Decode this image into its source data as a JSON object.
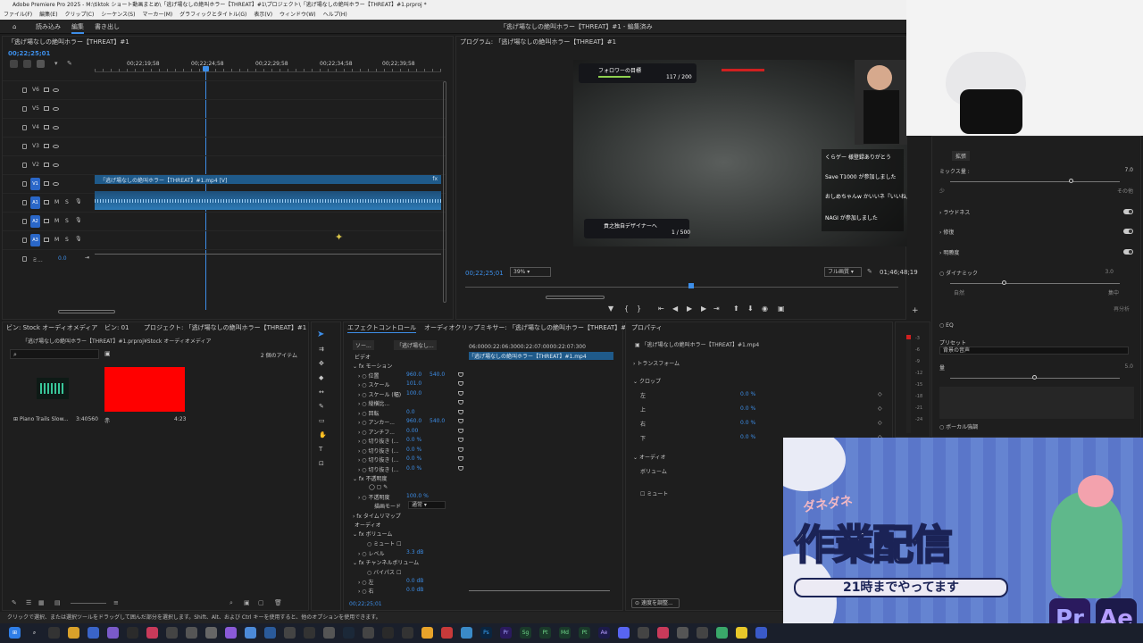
{
  "window": {
    "title": "Adobe Premiere Pro 2025 - M:\\tiktok ショート動画まとめ\\「逃げ場なしの絶叫ホラー【THREAT】#1\\プロジェクト\\「逃げ場なしの絶叫ホラー【THREAT】#1.prproj *"
  },
  "menu": [
    "ファイル(F)",
    "編集(E)",
    "クリップ(C)",
    "シーケンス(S)",
    "マーカー(M)",
    "グラフィックとタイトル(G)",
    "表示(V)",
    "ウィンドウ(W)",
    "ヘルプ(H)"
  ],
  "workspace": {
    "tabs": [
      "読み込み",
      "編集",
      "書き出し"
    ],
    "active_title": "「逃げ場なしの絶叫ホラー【THREAT】#1 - 編集済み"
  },
  "timeline": {
    "tab_title": "「逃げ場なしの絶叫ホラー【THREAT】#1",
    "timecode": "00;22;25;01",
    "ruler": [
      "00;22;19;58",
      "00;22;24;58",
      "00;22;29;58",
      "00;22;34;58",
      "00;22;39;58"
    ],
    "video_tracks": [
      "V6",
      "V5",
      "V4",
      "V3",
      "V2",
      "V1"
    ],
    "audio_tracks": [
      "A1",
      "A2",
      "A3"
    ],
    "mix_label": "ミ...",
    "mix_value": "0.0",
    "clip_label": "「逃げ場なしの絶叫ホラー【THREAT】#1.mp4 [V]",
    "fx_label": "fx"
  },
  "program": {
    "title": "プログラム: 「逃げ場なしの絶叫ホラー【THREAT】#1",
    "timecode": "00;22;25;01",
    "zoom": "39%",
    "quality": "フル画質",
    "duration": "01;46;48;19",
    "overlay_top_label": "フォロワーの目標",
    "overlay_top_count": "117 / 200",
    "overlay_bottom_label": "貢之独自デザイナーへ",
    "overlay_bottom_count": "1 / 500",
    "chat": [
      "くらゲー 様登録ありがとう",
      "Save T1000 が参加しました",
      "おしめちゃんw かいいネ『いいね』",
      "NAGI が参加しました"
    ]
  },
  "project_panel": {
    "tabs": [
      "ビン: Stock オーディオメディア",
      "ビン: 01",
      "プロジェクト: 「逃げ場なしの絶叫ホラー【THREAT】#1"
    ],
    "path": "「逃げ場なしの絶叫ホラー【THREAT】#1.prproj¥Stock オーディオメディア",
    "item_count": "2 個のアイテム",
    "item1_name": "Piano Trails Slow...",
    "item1_duration": "3:40560",
    "item2_name": "赤",
    "item2_duration": "4:23"
  },
  "effect_controls": {
    "tabs": [
      "エフェクトコントロール",
      "オーディオクリップミキサー: 「逃げ場なしの絶叫ホラー【THREAT】#1"
    ],
    "source_tab": "ソー...",
    "seq_tab": "「逃げ場なし...",
    "ruler": "06:0000:22:06:3000:22:07:0000:22:07:300",
    "clip_name": "「逃げ場なしの絶叫ホラー【THREAT】#1.mp4",
    "video_header": "ビデオ",
    "motion": "モーション",
    "rows": [
      {
        "name": "位置",
        "v1": "960.0",
        "v2": "540.0"
      },
      {
        "name": "スケール",
        "v1": "101.0",
        "v2": ""
      },
      {
        "name": "スケール (幅)",
        "v1": "100.0",
        "v2": ""
      },
      {
        "name": "縦横比...",
        "v1": "",
        "v2": ""
      },
      {
        "name": "回転",
        "v1": "0.0",
        "v2": ""
      },
      {
        "name": "アンカー...",
        "v1": "960.0",
        "v2": "540.0"
      },
      {
        "name": "アンチフ...",
        "v1": "0.00",
        "v2": ""
      },
      {
        "name": "切り抜き (...",
        "v1": "0.0 %",
        "v2": ""
      },
      {
        "name": "切り抜き (...",
        "v1": "0.0 %",
        "v2": ""
      },
      {
        "name": "切り抜き (...",
        "v1": "0.0 %",
        "v2": ""
      },
      {
        "name": "切り抜き (...",
        "v1": "0.0 %",
        "v2": ""
      }
    ],
    "opacity": "不透明度",
    "opacity_row": {
      "name": "不透明度",
      "v1": "100.0 %"
    },
    "blend_mode": "描画モード",
    "blend_value": "通常",
    "time_remap": "タイムリマップ",
    "audio_header": "オーディオ",
    "volume": "ボリューム",
    "mute": "ミュート",
    "level": "レベル",
    "level_value": "3.3 dB",
    "channel_volume": "チャンネルボリューム",
    "bypass": "バイパス",
    "left": "左",
    "left_value": "0.0 dB",
    "right": "右",
    "right_value": "0.0 dB",
    "timecode": "00;22;25;01"
  },
  "properties": {
    "title": "プロパティ",
    "clip_name": "「逃げ場なしの絶叫ホラー【THREAT】#1.mp4",
    "transform": "トランスフォーム",
    "crop": "クロップ",
    "crop_rows": [
      {
        "name": "左",
        "value": "0.0 %"
      },
      {
        "name": "上",
        "value": "0.0 %"
      },
      {
        "name": "右",
        "value": "0.0 %"
      },
      {
        "name": "下",
        "value": "0.0 %"
      }
    ],
    "audio": "オーディオ",
    "volume": "ボリューム",
    "mute": "ミュート",
    "speed_button": "速度を調整..."
  },
  "essential_sound": {
    "extend": "拡張",
    "mix_amount": "ミックス量 :",
    "mix_value": "7.0",
    "mix_low": "少",
    "mix_high": "その他",
    "loudness": "ラウドネス",
    "repair": "修復",
    "clarity": "明瞭度",
    "dynamic": "ダイナミック",
    "dynamic_value": "3.0",
    "dyn_low": "自然",
    "dyn_high": "集中",
    "reset": "再分析",
    "eq": "EQ",
    "preset": "プリセット",
    "preset_value": "背景の音声",
    "amount": "量",
    "amount_value": "5.0",
    "vocal": "ボーカル強調"
  },
  "banner": {
    "small_text": "ダネダネ",
    "big_text": "作業配信",
    "sub_text": "21時までやってます",
    "badge1": "Pr",
    "badge2": "Ae"
  },
  "status": {
    "text": "クリックで選択、または選択ツールをドラッグして囲んだ部分を選択します。Shift、Alt、および Ctrl キーを使用すると、他のオプションを使用できます。"
  },
  "taskbar": [
    "Ps",
    "Pr",
    "Sg",
    "Pt",
    "Md",
    "Pt",
    "Ae"
  ],
  "colors": {
    "accent": "#3d8ee8",
    "red_swatch": "#ff0000",
    "banner_bg": "#5a76c9",
    "pr": "#2a1a5e",
    "ae": "#1c1a4a"
  }
}
